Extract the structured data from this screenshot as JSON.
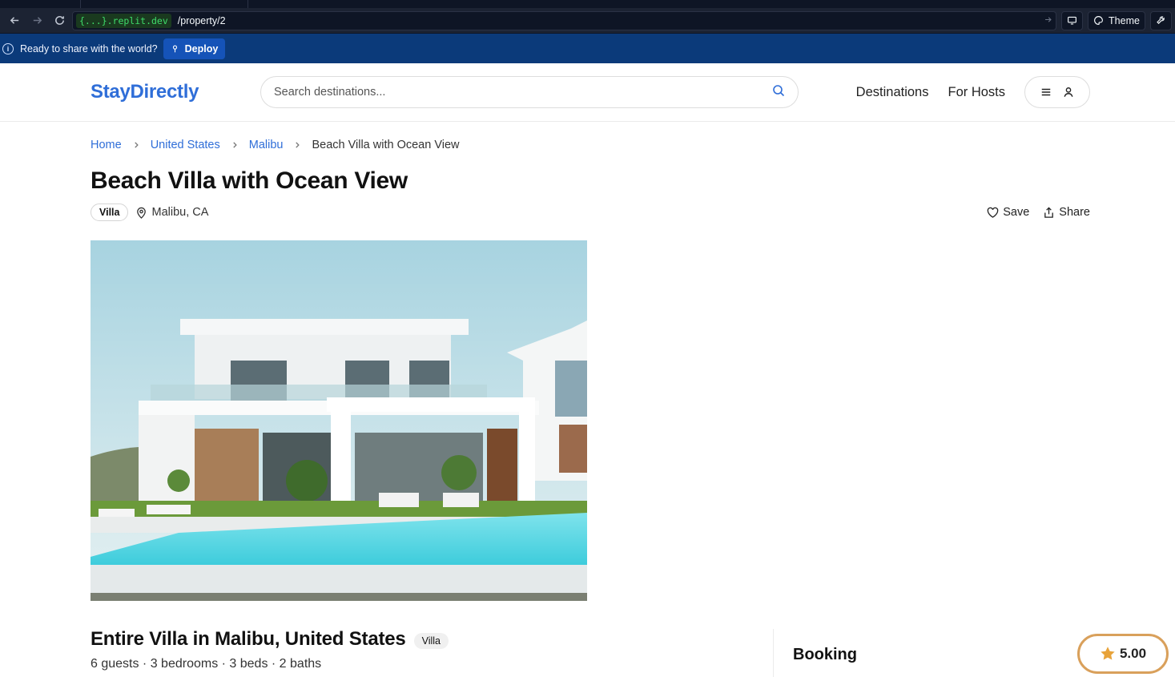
{
  "browser": {
    "domain": "{...}.replit.dev",
    "path": "/property/2",
    "theme_label": "Theme"
  },
  "deploy_bar": {
    "message": "Ready to share with the world?",
    "button_label": "Deploy"
  },
  "header": {
    "logo": "StayDirectly",
    "search_placeholder": "Search destinations...",
    "nav": [
      "Destinations",
      "For Hosts"
    ]
  },
  "breadcrumb": [
    "Home",
    "United States",
    "Malibu",
    "Beach Villa with Ocean View"
  ],
  "property": {
    "title": "Beach Villa with Ocean View",
    "type": "Villa",
    "location": "Malibu, CA",
    "save_label": "Save",
    "share_label": "Share",
    "subtitle": "Entire Villa in Malibu, United States",
    "subtitle_badge": "Villa",
    "specs": "6 guests · 3 bedrooms · 3 beds · 2 baths"
  },
  "booking": {
    "heading": "Booking",
    "rating": "5.00"
  },
  "colors": {
    "brand": "#2f6ed8",
    "deploy_bar": "#0b3a7a",
    "rating_border": "#d9a05b",
    "star": "#e8a33a"
  }
}
